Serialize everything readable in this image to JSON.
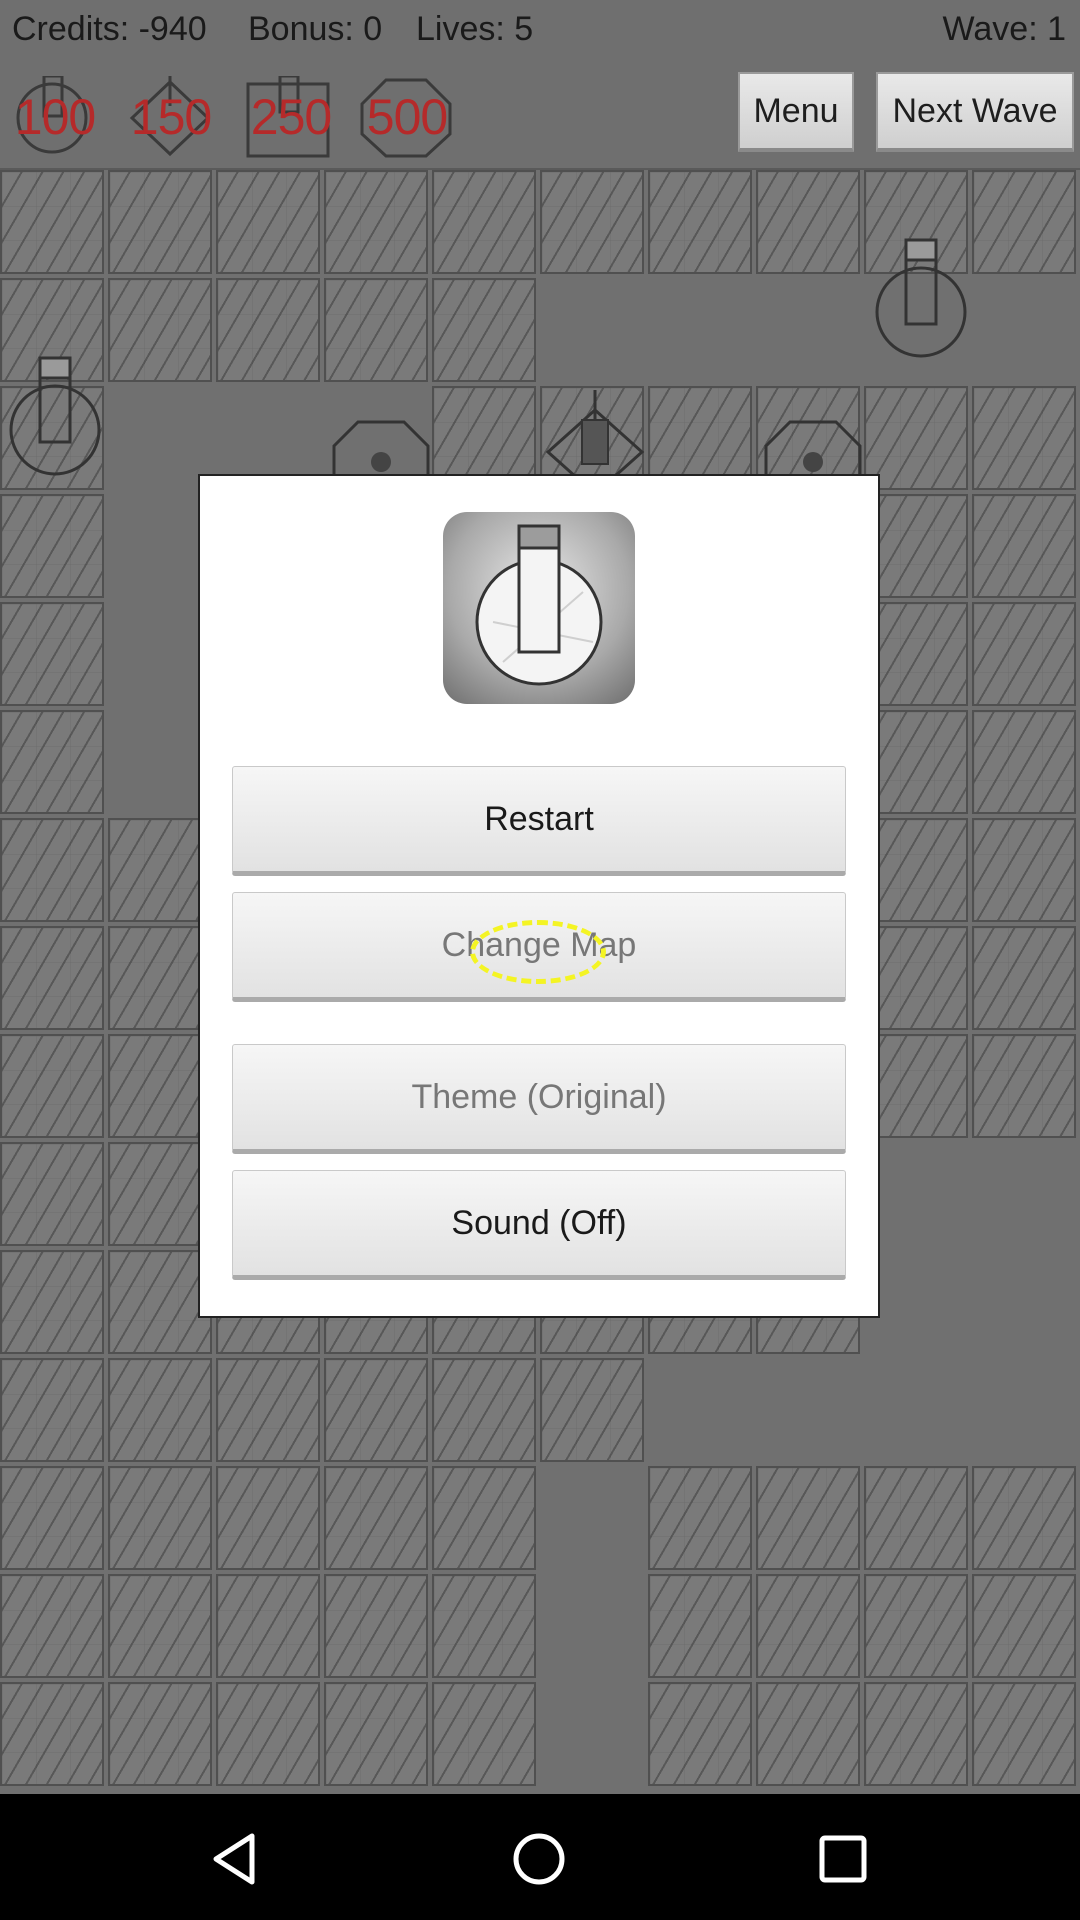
{
  "hud": {
    "credits": "Credits: -940",
    "bonus": "Bonus: 0",
    "lives": "Lives: 5",
    "wave": "Wave: 1",
    "tower_costs": [
      "100",
      "150",
      "250",
      "500"
    ],
    "menu_label": "Menu",
    "next_wave_label": "Next Wave"
  },
  "dialog": {
    "icon": "cannon-tower-icon",
    "buttons": {
      "restart": "Restart",
      "change_map": "Change Map",
      "theme": "Theme (Original)",
      "sound": "Sound (Off)"
    }
  },
  "navbar": {
    "icons": [
      "back-icon",
      "home-icon",
      "recents-icon"
    ]
  },
  "colors": {
    "cost_text": "#b52a2a",
    "tap_indicator": "#f4f424",
    "board_bg": "#707070"
  }
}
